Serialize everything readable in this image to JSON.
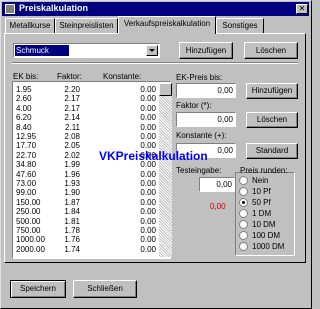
{
  "window": {
    "title": "Preiskalkulation"
  },
  "tabs": [
    {
      "label": "Metallkurse",
      "active": false
    },
    {
      "label": "Steinpreislisten",
      "active": false
    },
    {
      "label": "Verkaufspreiskalkulation",
      "active": true
    },
    {
      "label": "Sonstiges",
      "active": false
    }
  ],
  "category": {
    "value": "Schmuck"
  },
  "buttons": {
    "hinzufuegen_top": "Hinzufügen",
    "loeschen_top": "Löschen",
    "hinzufuegen": "Hinzufügen",
    "loeschen": "Löschen",
    "standard": "Standard",
    "speichern": "Speichern",
    "schliessen": "Schließen"
  },
  "table": {
    "headers": [
      "EK bis:",
      "Faktor:",
      "Konstante:"
    ],
    "rows": [
      [
        "1.95",
        "2.20",
        "0.00"
      ],
      [
        "2.60",
        "2.17",
        "0.00"
      ],
      [
        "4.00",
        "2.17",
        "0.00"
      ],
      [
        "6.20",
        "2.14",
        "0.00"
      ],
      [
        "8.40",
        "2.11",
        "0.00"
      ],
      [
        "12.95",
        "2.08",
        "0.00"
      ],
      [
        "17.70",
        "2.05",
        "0.00"
      ],
      [
        "22.70",
        "2.02",
        "0.00"
      ],
      [
        "34.80",
        "1.99",
        "0.00"
      ],
      [
        "47.60",
        "1.96",
        "0.00"
      ],
      [
        "73.00",
        "1.93",
        "0.00"
      ],
      [
        "99.00",
        "1.90",
        "0.00"
      ],
      [
        "150.00",
        "1.87",
        "0.00"
      ],
      [
        "250.00",
        "1.84",
        "0.00"
      ],
      [
        "500.00",
        "1.81",
        "0.00"
      ],
      [
        "750.00",
        "1.78",
        "0.00"
      ],
      [
        "1000.00",
        "1.76",
        "0.00"
      ],
      [
        "2000.00",
        "1.74",
        "0.00"
      ]
    ]
  },
  "watermark": "VKPreiskalkulation",
  "form": {
    "ek_label": "EK-Preis bis:",
    "ek_value": "0,00",
    "faktor_label": "Faktor (*):",
    "faktor_value": "0,00",
    "konstante_label": "Konstante (+):",
    "konstante_value": "0,00",
    "test_label": "Testeingabe:",
    "test_value": "0,00",
    "result_value": "0,00",
    "result_color": "#cc0000"
  },
  "rounding": {
    "title": "Preis runden:",
    "options": [
      "Nein",
      "10 Pf",
      "50 Pf",
      "1 DM",
      "10 DM",
      "100 DM",
      "1000 DM"
    ],
    "selected_index": 2
  }
}
